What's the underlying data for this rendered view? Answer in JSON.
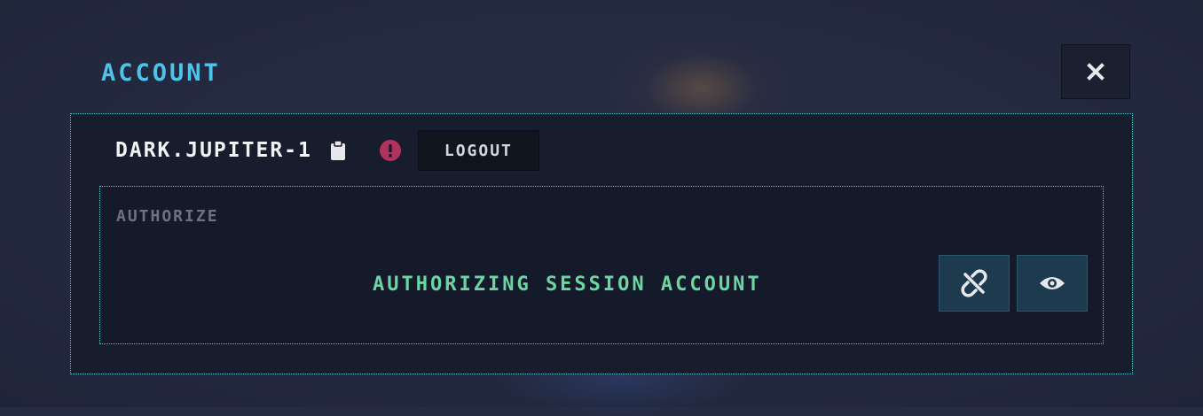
{
  "header": {
    "title": "ACCOUNT",
    "close_icon": "close-icon"
  },
  "account": {
    "username": "DARK.JUPITER-1",
    "copy_icon": "clipboard-icon",
    "warning_icon": "exclamation-circle-icon",
    "logout_label": "LOGOUT"
  },
  "authorize": {
    "label": "AUTHORIZE",
    "status": "AUTHORIZING SESSION ACCOUNT",
    "unlink_icon": "unlink-icon",
    "view_icon": "eye-icon"
  },
  "colors": {
    "background": "#252b42",
    "title": "#4fc3e8",
    "status": "#6cd6a2",
    "warning": "#b0335f",
    "border": "#5fc4cc",
    "icon_button_bg": "#1e3a4f"
  }
}
